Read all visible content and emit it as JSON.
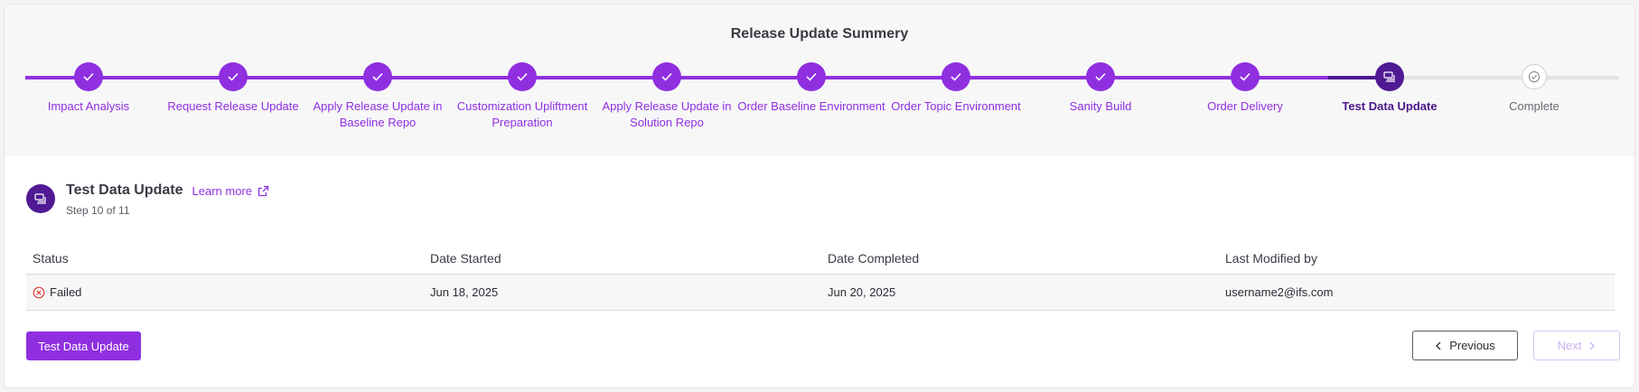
{
  "summary": {
    "title": "Release Update Summery"
  },
  "steps": [
    {
      "label": "Impact Analysis",
      "state": "done"
    },
    {
      "label": "Request Release Update",
      "state": "done"
    },
    {
      "label": "Apply Release Update in Baseline Repo",
      "state": "done"
    },
    {
      "label": "Customization Upliftment Preparation",
      "state": "done"
    },
    {
      "label": "Apply Release Update in Solution Repo",
      "state": "done"
    },
    {
      "label": "Order Baseline Environment",
      "state": "done"
    },
    {
      "label": "Order Topic Environment",
      "state": "done"
    },
    {
      "label": "Sanity Build",
      "state": "done"
    },
    {
      "label": "Order Delivery",
      "state": "done"
    },
    {
      "label": "Test Data Update",
      "state": "active"
    },
    {
      "label": "Complete",
      "state": "pending"
    }
  ],
  "detail": {
    "title": "Test Data Update",
    "learn_more": "Learn more",
    "step_count": "Step 10 of 11"
  },
  "table": {
    "headers": [
      "Status",
      "Date Started",
      "Date Completed",
      "Last Modified by"
    ],
    "row": {
      "status": "Failed",
      "date_started": "Jun 18, 2025",
      "date_completed": "Jun 20, 2025",
      "modified_by": "username2@ifs.com"
    }
  },
  "actions": {
    "primary_label": "Test Data Update",
    "previous_label": "Previous",
    "next_label": "Next"
  },
  "colors": {
    "accent": "#8f2fe0",
    "active": "#4f1a93",
    "error": "#e0403a"
  }
}
